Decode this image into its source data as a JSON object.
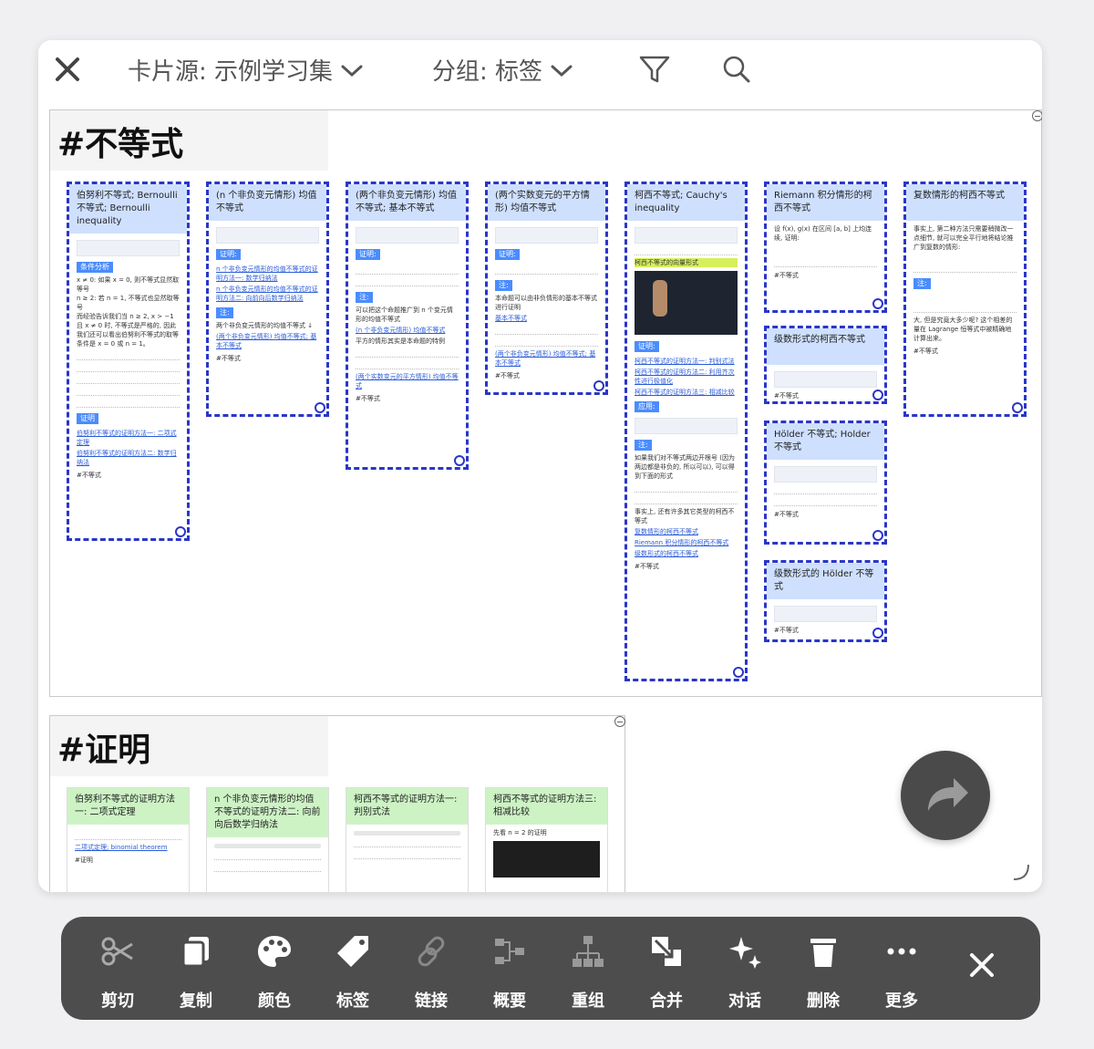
{
  "topbar": {
    "close_icon": "close-icon",
    "source_label": "卡片源: 示例学习集",
    "group_label": "分组: 标签",
    "filter_icon": "filter-icon",
    "search_icon": "search-icon"
  },
  "groups": [
    {
      "title": "#不等式",
      "cards": [
        {
          "title": "伯努利不等式; Bernoulli 不等式; Bernoulli inequality",
          "sections": [
            "条件分析",
            "证明"
          ],
          "lines": [
            "x ≠ 0: 如果 x = 0, 则不等式显然取等号",
            "n ≥ 2: 若 n = 1, 不等式也显然取等号",
            "而经验告诉我们当 n ≥ 2, x > −1 且 x ≠ 0 时, 不等式是严格的, 因此我们还可以看出伯努利不等式的取等条件是 x = 0 或 n = 1。"
          ],
          "links": [
            "伯努利不等式的证明方法一: 二项式定理",
            "伯努利不等式的证明方法二: 数学归纳法"
          ],
          "tag": "#不等式"
        },
        {
          "title": "(n 个非负变元情形) 均值不等式",
          "sections": [
            "证明:",
            "注:"
          ],
          "links": [
            "n 个非负变元情形的均值不等式的证明方法一: 数学归纳法",
            "n 个非负变元情形的均值不等式的证明方法二: 向前向后数学归纳法",
            "(两个非负变元情形) 均值不等式; 基本不等式"
          ],
          "lines": [
            "两个非负变元情形的均值不等式 ↓"
          ],
          "tag": "#不等式"
        },
        {
          "title": "(两个非负变元情形) 均值不等式; 基本不等式",
          "sections": [
            "证明:",
            "注:"
          ],
          "lines": [
            "可以把这个命题推广到 n 个变元情形的均值不等式",
            "平方的情形其实是本命题的特例"
          ],
          "links": [
            "(n 个非负变元情形) 均值不等式",
            "(两个实数变元的平方情形) 均值不等式"
          ],
          "tag": "#不等式"
        },
        {
          "title": "(两个实数变元的平方情形) 均值不等式",
          "sections": [
            "证明:",
            "注:"
          ],
          "lines": [
            "本命题可以由非负情形的基本不等式进行证明"
          ],
          "links": [
            "基本不等式",
            "(两个非负变元情形) 均值不等式; 基本不等式"
          ],
          "tag": "#不等式"
        },
        {
          "title": "柯西不等式; Cauchy's inequality",
          "sections": [
            "证明:",
            "应用:",
            "注:"
          ],
          "highlight": "柯西不等式的向量形式",
          "lines": [
            "如果我们对不等式两边开根号 (因为两边都是非负的, 所以可以), 可以得到下面的形式",
            "事实上, 还有许多其它类型的柯西不等式"
          ],
          "links": [
            "柯西不等式的证明方法一: 判别式法",
            "柯西不等式的证明方法二: 利用齐次性进行极值化",
            "柯西不等式的证明方法三: 相减比较",
            "复数情形的柯西不等式",
            "Riemann 积分情形的柯西不等式",
            "级数形式的柯西不等式"
          ],
          "tag": "#不等式"
        },
        {
          "title": "Riemann 积分情形的柯西不等式",
          "lines": [
            "设 f(x), g(x) 在区间 [a, b] 上均连续, 证明:"
          ],
          "tag": "#不等式"
        },
        {
          "title": "级数形式的柯西不等式",
          "tag": "#不等式"
        },
        {
          "title": "Hölder 不等式; Holder 不等式",
          "tag": "#不等式"
        },
        {
          "title": "级数形式的 Hölder 不等式",
          "tag": "#不等式"
        },
        {
          "title": "复数情形的柯西不等式",
          "sections": [
            "注:"
          ],
          "lines": [
            "事实上, 第二种方法只需要稍微改一点细节, 就可以完全平行地将结论推广到复数的情形:",
            "大, 但是究竟大多少呢? 这个相差的量在 Lagrange 恒等式中被精确地计算出来。"
          ],
          "tag": "#不等式"
        }
      ]
    },
    {
      "title": "#证明",
      "cards": [
        {
          "title": "伯努利不等式的证明方法一: 二项式定理",
          "links": [
            "二项式定理; binomial theorem"
          ],
          "tag": "#证明"
        },
        {
          "title": "n 个非负变元情形的均值不等式的证明方法二: 向前向后数学归纳法"
        },
        {
          "title": "柯西不等式的证明方法一: 判别式法"
        },
        {
          "title": "柯西不等式的证明方法三: 相减比较",
          "lines": [
            "先看 n = 2 的证明"
          ]
        }
      ]
    }
  ],
  "fab": {
    "icon": "share-icon"
  },
  "toolbar": {
    "items": [
      {
        "icon": "scissors-icon",
        "label": "剪切"
      },
      {
        "icon": "copy-icon",
        "label": "复制"
      },
      {
        "icon": "palette-icon",
        "label": "颜色"
      },
      {
        "icon": "tag-icon",
        "label": "标签"
      },
      {
        "icon": "link-icon",
        "label": "链接"
      },
      {
        "icon": "outline-icon",
        "label": "概要"
      },
      {
        "icon": "regroup-icon",
        "label": "重组"
      },
      {
        "icon": "merge-icon",
        "label": "合并"
      },
      {
        "icon": "sparkle-icon",
        "label": "对话"
      },
      {
        "icon": "trash-icon",
        "label": "删除"
      },
      {
        "icon": "more-icon",
        "label": "更多"
      }
    ],
    "close_icon": "close-icon"
  }
}
